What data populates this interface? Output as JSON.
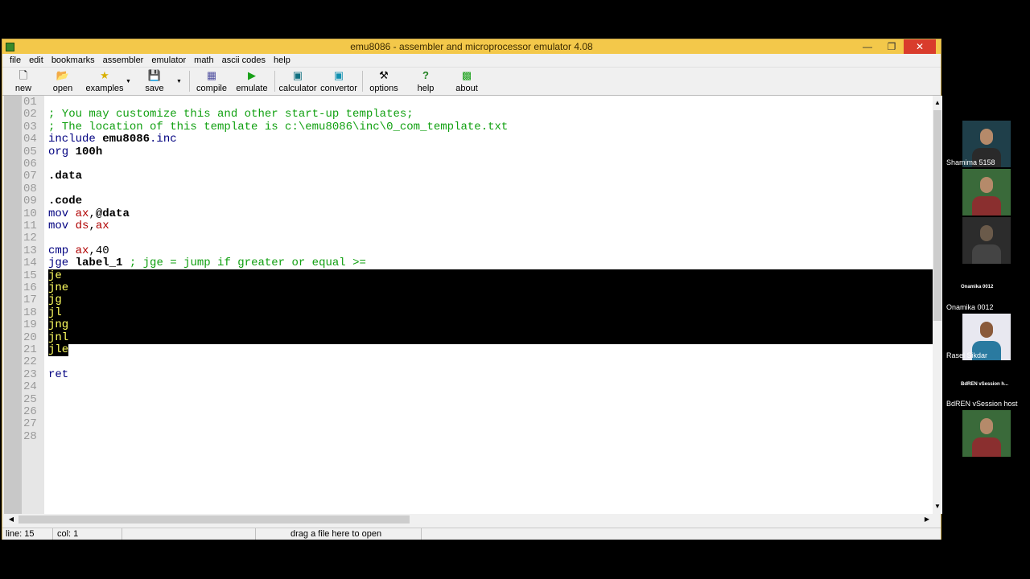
{
  "window": {
    "title": "emu8086 - assembler and microprocessor emulator 4.08",
    "buttons": {
      "minimize": "—",
      "maximize": "❐",
      "close": "✕"
    }
  },
  "menu": [
    "file",
    "edit",
    "bookmarks",
    "assembler",
    "emulator",
    "math",
    "ascii codes",
    "help"
  ],
  "toolbar": {
    "new": "new",
    "open": "open",
    "examples": "examples",
    "save": "save",
    "compile": "compile",
    "emulate": "emulate",
    "calculator": "calculator",
    "convertor": "convertor",
    "options": "options",
    "help": "help",
    "about": "about"
  },
  "editor": {
    "line_numbers": [
      "01",
      "02",
      "03",
      "04",
      "05",
      "06",
      "07",
      "08",
      "09",
      "10",
      "11",
      "12",
      "13",
      "14",
      "15",
      "16",
      "17",
      "18",
      "19",
      "20",
      "21",
      "22",
      "23",
      "24",
      "25",
      "26",
      "27",
      "28"
    ],
    "l02": "; You may customize this and other start-up templates;",
    "l03": "; The location of this template is c:\\emu8086\\inc\\0_com_template.txt",
    "l04": {
      "kw": "include",
      "arg": "emu8086",
      "ext": ".inc"
    },
    "l05": {
      "kw": "org",
      "arg": "100h"
    },
    "l07": ".data",
    "l09": ".code",
    "l10": {
      "kw": "mov",
      "reg": "ax",
      "sep": ",",
      "arg": "@data"
    },
    "l11": {
      "kw": "mov",
      "reg": "ds",
      "sep": ",",
      "reg2": "ax"
    },
    "l13": {
      "kw": "cmp",
      "reg": "ax",
      "sep": ",",
      "arg": "40"
    },
    "l14": {
      "kw": "jge",
      "arg": "label_1",
      "comment": "; jge = jump if greater or equal >="
    },
    "l15": "je",
    "l16": "jne",
    "l17": "jg",
    "l18": "jl",
    "l19": "jng",
    "l20": "jnl",
    "l21": "jle",
    "l23": "ret"
  },
  "status": {
    "line": "line: 15",
    "col": "col: 1",
    "hint": "drag a file here to open"
  },
  "participants": [
    {
      "name": "Shamima 5158"
    },
    {
      "name": "Onamika 0012"
    },
    {
      "name": "Onamika 0012"
    },
    {
      "name": "Rasel Sikdar"
    },
    {
      "name": "BdREN vSession h..."
    },
    {
      "name": "BdREN vSession host"
    }
  ]
}
